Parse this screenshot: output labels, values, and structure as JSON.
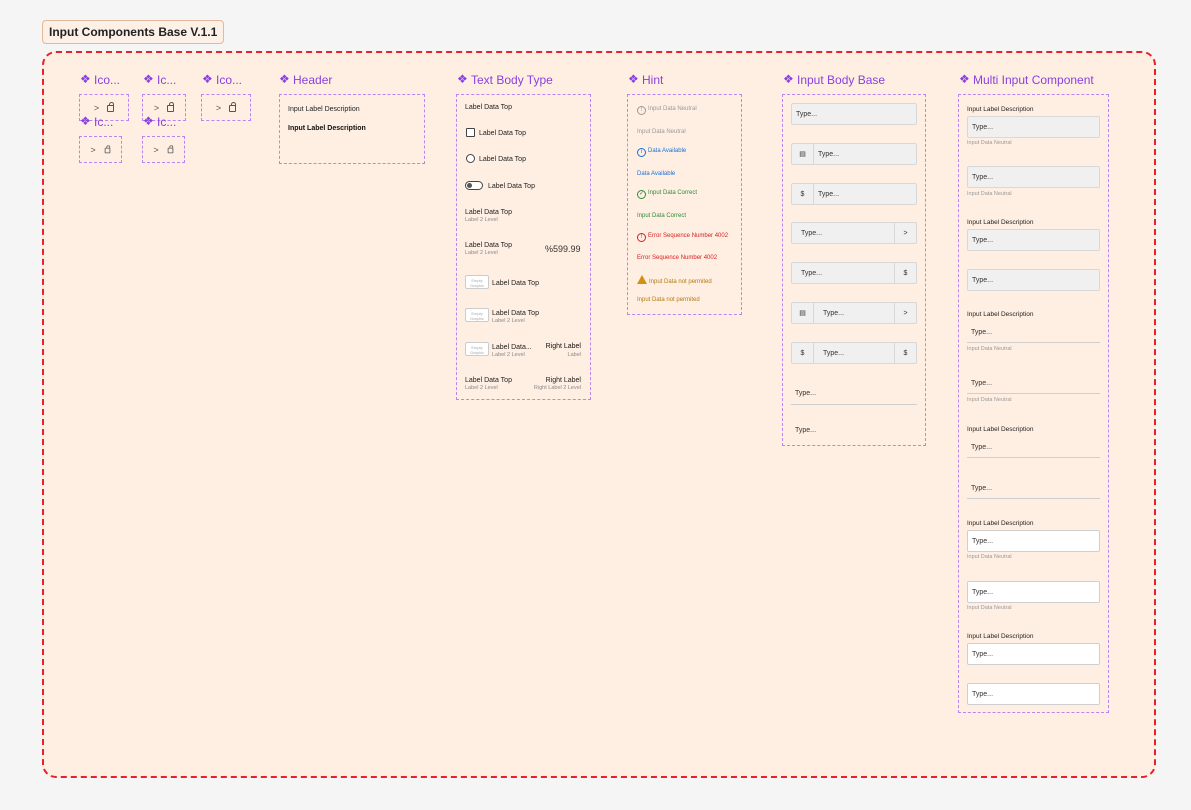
{
  "page": {
    "title": "Input Components Base V.1.1"
  },
  "icons": {
    "title1": "Ico...",
    "title2": "Ic...",
    "title3": "Ico...",
    "title4": "Ic...",
    "title5": "Ic...",
    "chevron": ">"
  },
  "header": {
    "title": "Header",
    "line1": "Input Label Description",
    "line2": "Input Label Description"
  },
  "text_body": {
    "title": "Text Body Type",
    "plain_label": "Label Data Top",
    "checkbox_label": "Label Data Top",
    "radio_label": "Label Data Top",
    "toggle_label": "Label Data Top",
    "two_level": {
      "top": "Label Data Top",
      "sub": "Label 2 Level"
    },
    "price_row": {
      "top": "Label Data Top",
      "sub": "Label 2 Level",
      "value": "%599.99"
    },
    "graphic_row": {
      "graphic": "Empty Graphic",
      "label": "Label Data Top"
    },
    "graphic_two_level": {
      "graphic": "Empty Graphic",
      "top": "Label Data Top",
      "sub": "Label 2 Level"
    },
    "graphic_right": {
      "graphic": "Empty Graphic",
      "top": "Label Data...",
      "sub": "Label 2 Level",
      "right_top": "Right Label",
      "right_sub": "Label"
    },
    "right_row": {
      "top": "Label Data Top",
      "sub": "Label 2 Level",
      "right_top": "Right Label",
      "right_sub": "Right Label 2 Level"
    }
  },
  "hint": {
    "title": "Hint",
    "items": [
      {
        "text": "Input Data Neutral",
        "icon": "info-icon",
        "glyph": "!",
        "color": "#999999"
      },
      {
        "text": "Input Data Neutral",
        "color": "#999999"
      },
      {
        "text": "Data Available",
        "icon": "info-icon",
        "glyph": "i",
        "color": "#1a6fd6"
      },
      {
        "text": "Data Available",
        "color": "#1a6fd6"
      },
      {
        "text": "Input Data Correct",
        "icon": "check-circle-icon",
        "glyph": "✓",
        "color": "#2e8b3a"
      },
      {
        "text": "Input Data Correct",
        "color": "#2e8b3a"
      },
      {
        "text": "Error Sequence Number 4002",
        "icon": "error-icon",
        "glyph": "!",
        "color": "#d42020"
      },
      {
        "text": "Error Sequence Number 4002",
        "color": "#d42020"
      },
      {
        "text": "Input Data not permited",
        "icon": "warning-icon",
        "glyph": "!",
        "color": "#b07a10"
      },
      {
        "text": "Input Data not permited",
        "color": "#b07a10"
      }
    ]
  },
  "input_base": {
    "title": "Input Body Base",
    "placeholder": "Type...",
    "currency": "$",
    "chevron": ">",
    "chart_glyph": "▤"
  },
  "multi": {
    "title": "Multi Input Component",
    "label": "Input Label Description",
    "placeholder": "Type...",
    "hint": "Input Data Neutral"
  },
  "colors": {
    "accent": "#8a3fe0",
    "frame_border": "#e8202a",
    "frame_bg": "#ffefe3"
  }
}
